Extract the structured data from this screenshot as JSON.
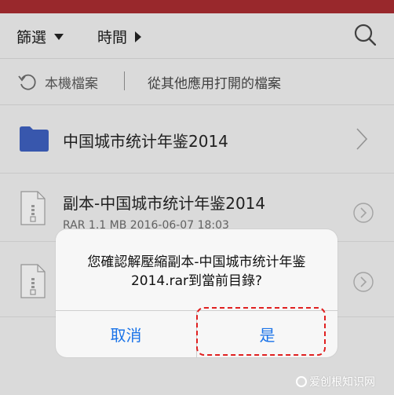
{
  "toolbar": {
    "filter_label": "篩選",
    "time_label": "時間"
  },
  "source_bar": {
    "local_label": "本機檔案",
    "other_label": "從其他應用打開的檔案"
  },
  "files": [
    {
      "name": "中国城市统计年鉴2014",
      "icon": "folder-icon"
    },
    {
      "name": "副本-中国城市统计年鉴2014",
      "meta": "RAR  1.1 MB  2016-06-07 18:03",
      "icon": "archive-icon"
    },
    {
      "icon": "archive-icon"
    }
  ],
  "dialog": {
    "message_line1": "您確認解壓縮副本-中国城市统计年鉴",
    "message_line2": "2014.rar到當前目錄?",
    "cancel_label": "取消",
    "confirm_label": "是"
  },
  "watermark": "爱创根知识网",
  "colors": {
    "accent": "#1a73e8",
    "top_bar": "#a02a2e",
    "highlight": "#e02020",
    "folder": "#3b5bb5"
  }
}
